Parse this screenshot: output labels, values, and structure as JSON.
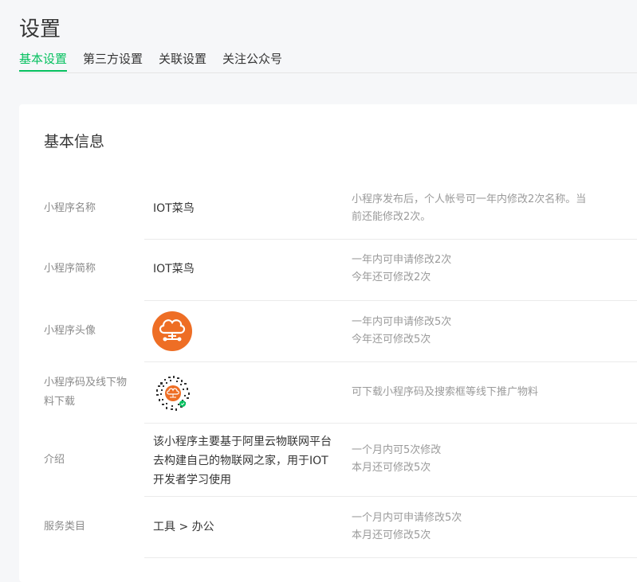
{
  "page": {
    "title": "设置"
  },
  "tabs": [
    {
      "label": "基本设置",
      "active": true
    },
    {
      "label": "第三方设置",
      "active": false
    },
    {
      "label": "关联设置",
      "active": false
    },
    {
      "label": "关注公众号",
      "active": false
    }
  ],
  "basic_info": {
    "title": "基本信息",
    "rows": [
      {
        "label": "小程序名称",
        "value": "IOT菜鸟",
        "tip_lines": [
          "小程序发布后，个人帐号可一年内修改2次名称。当",
          "前还能修改2次。"
        ]
      },
      {
        "label": "小程序简称",
        "value": "IOT菜鸟",
        "tip_lines": [
          "一年内可申请修改2次",
          "今年还可修改2次"
        ]
      },
      {
        "label": "小程序头像",
        "value": "",
        "tip_lines": [
          "一年内可申请修改5次",
          "今年还可修改5次"
        ]
      },
      {
        "label_lines": [
          "小程序码及线下物",
          "料下载"
        ],
        "value": "",
        "tip_lines": [
          "可下载小程序码及搜索框等线下推广物料"
        ]
      },
      {
        "label": "介绍",
        "value_lines": [
          "该小程序主要基于阿里云物联网平台",
          "去构建自己的物联网之家，用于IOT",
          "开发者学习使用"
        ],
        "tip_lines": [
          "一个月内可5次修改",
          "本月还可修改5次"
        ]
      },
      {
        "label": "服务类目",
        "value": "工具 > 办公",
        "tip_lines": [
          "一个月内可申请修改5次",
          "本月还可修改5次"
        ]
      }
    ]
  },
  "colors": {
    "accent": "#07c160",
    "avatar_bg": "#ee6e25",
    "label": "#8a8a8a",
    "tip": "#9a9a9a"
  },
  "icons": {
    "avatar": "cloud-network-icon",
    "qrcode": "mini-program-code-icon"
  }
}
